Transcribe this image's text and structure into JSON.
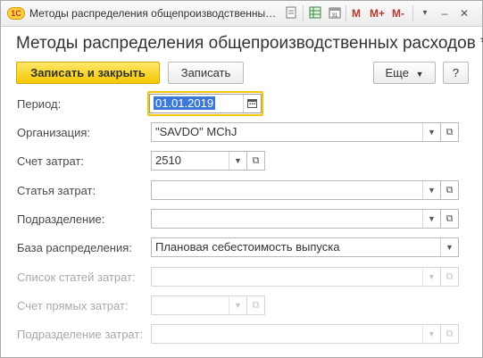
{
  "window": {
    "title": "Методы распределения общепроизводственных расходов",
    "logo_text": "1С",
    "mem_buttons": [
      "M",
      "M+",
      "M-"
    ],
    "icons": [
      "document-icon",
      "grid-icon",
      "calendar-icon"
    ]
  },
  "form": {
    "title": "Методы распределения общепроизводственных расходов *"
  },
  "toolbar": {
    "save_close_label": "Записать и закрыть",
    "save_label": "Записать",
    "more_label": "Еще",
    "help_label": "?"
  },
  "fields": {
    "period": {
      "label": "Период:",
      "value": "01.01.2019"
    },
    "organization": {
      "label": "Организация:",
      "value": "\"SAVDO\" MChJ"
    },
    "cost_account": {
      "label": "Счет затрат:",
      "value": "2510"
    },
    "cost_item": {
      "label": "Статья затрат:",
      "value": ""
    },
    "department": {
      "label": "Подразделение:",
      "value": ""
    },
    "allocation_base": {
      "label": "База распределения:",
      "value": "Плановая себестоимость выпуска"
    },
    "cost_items_list": {
      "label": "Список статей затрат:",
      "value": ""
    },
    "direct_cost_account": {
      "label": "Счет прямых затрат:",
      "value": ""
    },
    "cost_department": {
      "label": "Подразделение затрат:",
      "value": ""
    }
  },
  "colors": {
    "primary_button": "#f3c800",
    "focus_border": "#f3c800",
    "selection": "#3c78d8"
  }
}
